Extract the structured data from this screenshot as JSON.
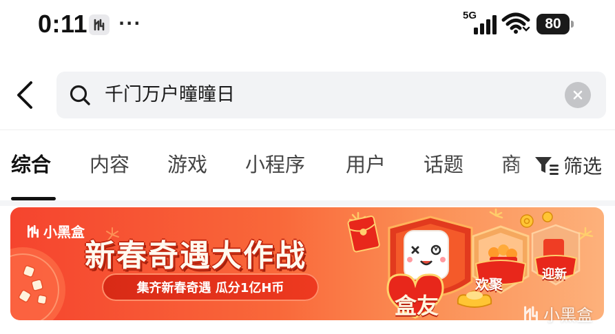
{
  "status_bar": {
    "time": "0:11",
    "more_dots": "···",
    "network": "5G",
    "battery": "80"
  },
  "search": {
    "query": "千门万户曈曈日"
  },
  "tabs": [
    {
      "label": "综合",
      "active": true
    },
    {
      "label": "内容",
      "active": false
    },
    {
      "label": "游戏",
      "active": false
    },
    {
      "label": "小程序",
      "active": false
    },
    {
      "label": "用户",
      "active": false
    },
    {
      "label": "话题",
      "active": false
    },
    {
      "label": "商",
      "active": false
    }
  ],
  "filter": {
    "label": "筛选"
  },
  "banner": {
    "brand": "小黑盒",
    "title": "新春奇遇大作战",
    "subtitle": "集齐新春奇遇 瓜分1亿H币",
    "badges": [
      "盒友",
      "欢聚",
      "迎新"
    ]
  },
  "watermark": {
    "text": "小黑盒"
  },
  "colors": {
    "banner_start": "#f5442e",
    "banner_end": "#fdb17b",
    "search_bg": "#f2f3f5",
    "active_tab": "#111111"
  }
}
